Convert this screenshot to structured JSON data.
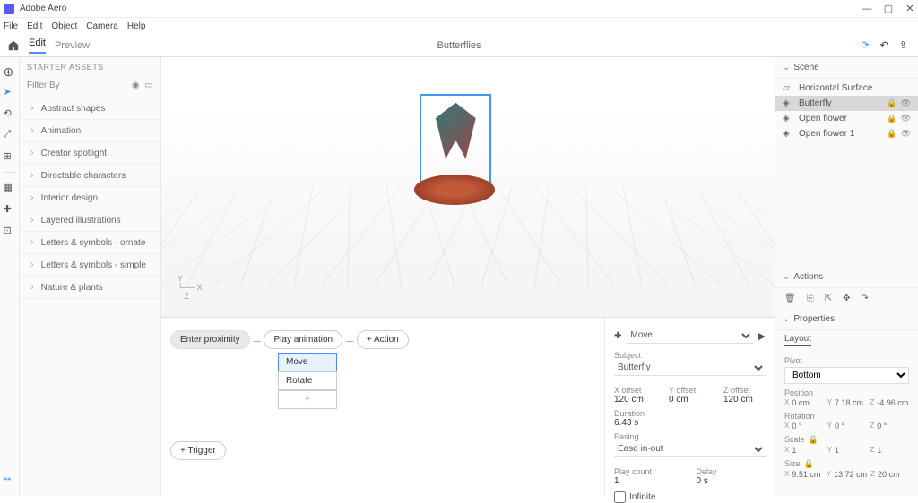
{
  "app": {
    "title": "Adobe Aero"
  },
  "menubar": [
    "File",
    "Edit",
    "Object",
    "Camera",
    "Help"
  ],
  "modes": {
    "edit": "Edit",
    "preview": "Preview"
  },
  "document_title": "Butterflies",
  "starter_assets": {
    "header": "STARTER ASSETS",
    "filter_label": "Filter By",
    "items": [
      "Abstract shapes",
      "Animation",
      "Creator spotlight",
      "Directable characters",
      "Interior design",
      "Layered illustrations",
      "Letters & symbols - ornate",
      "Letters & symbols - simple",
      "Nature & plants"
    ]
  },
  "scene": {
    "header": "Scene",
    "items": [
      {
        "icon": "surface",
        "label": "Horizontal Surface"
      },
      {
        "icon": "asset",
        "label": "Butterfly",
        "selected": true
      },
      {
        "icon": "asset",
        "label": "Open flower"
      },
      {
        "icon": "asset",
        "label": "Open flower 1"
      }
    ]
  },
  "actions_section": {
    "header": "Actions"
  },
  "properties": {
    "header": "Properties",
    "layout_tab": "Layout",
    "pivot_label": "Pivot",
    "pivot_value": "Bottom",
    "position_label": "Position",
    "position": {
      "x": "0 cm",
      "y": "7.18 cm",
      "z": "-4.96 cm"
    },
    "rotation_label": "Rotation",
    "rotation": {
      "x": "0 °",
      "y": "0 °",
      "z": "0 °"
    },
    "scale_label": "Scale",
    "scale": {
      "x": "1",
      "y": "1",
      "z": "1"
    },
    "size_label": "Size",
    "size": {
      "x": "9.51 cm",
      "y": "13.72 cm",
      "z": "20 cm"
    }
  },
  "behaviors": {
    "trigger_chip": "Enter proximity",
    "action_chip": "Play animation",
    "add_action_chip": "+ Action",
    "action_items": [
      "Move",
      "Rotate"
    ],
    "add_trigger": "+ Trigger"
  },
  "behavior_props": {
    "type": "Move",
    "subject_label": "Subject",
    "subject_value": "Butterfly",
    "x_offset_label": "X offset",
    "x_offset_value": "120 cm",
    "y_offset_label": "Y offset",
    "y_offset_value": "0 cm",
    "z_offset_label": "Z offset",
    "z_offset_value": "120 cm",
    "duration_label": "Duration",
    "duration_value": "6.43 s",
    "easing_label": "Easing",
    "easing_value": "Ease in-out",
    "play_count_label": "Play count",
    "play_count_value": "1",
    "delay_label": "Delay",
    "delay_value": "0 s",
    "infinite_label": "Infinite"
  }
}
